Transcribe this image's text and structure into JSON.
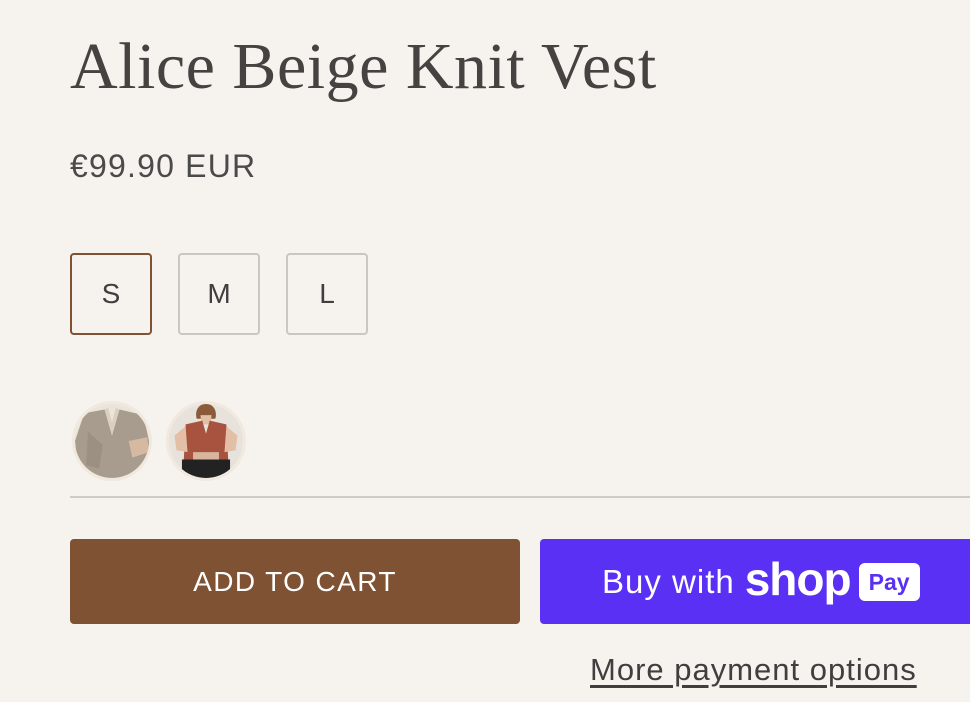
{
  "product": {
    "title": "Alice Beige Knit Vest",
    "price": "€99.90 EUR"
  },
  "sizes": [
    {
      "label": "S",
      "selected": true
    },
    {
      "label": "M",
      "selected": false
    },
    {
      "label": "L",
      "selected": false
    }
  ],
  "swatches": [
    {
      "name": "beige-swatch",
      "color": "#a89c90"
    },
    {
      "name": "rust-swatch",
      "color": "#a8533f"
    }
  ],
  "actions": {
    "add_to_cart": "ADD TO CART",
    "buy_with": "Buy with",
    "shop_word": "shop",
    "pay_badge": "Pay",
    "more_payment_options": "More payment options"
  },
  "colors": {
    "background": "#f6f2ee",
    "add_to_cart_bg": "#7f5233",
    "shop_pay_bg": "#5a31f4",
    "selected_border": "#7f5234"
  }
}
